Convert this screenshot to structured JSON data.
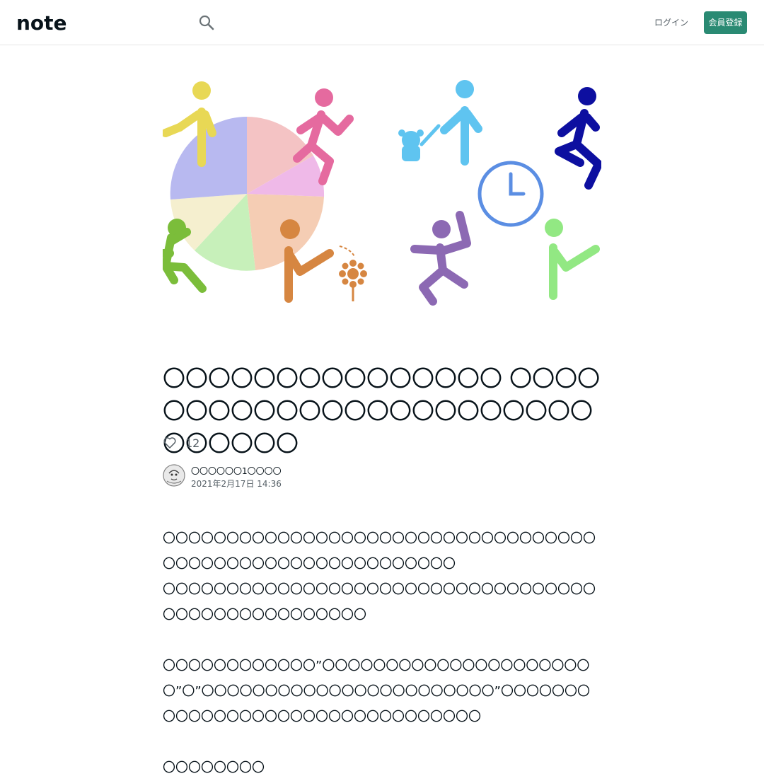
{
  "header": {
    "logo_text": "note",
    "login_label": "ログイン",
    "signup_label": "会員登録"
  },
  "colors": {
    "accent": "#2a8a73",
    "text": "#08131a",
    "muted": "#555f66"
  },
  "icons": {
    "search": "search-icon",
    "like": "heart-icon"
  },
  "article": {
    "title": "〇〇〇〇〇〇〇〇〇〇〇〇〇〇〇 〇〇〇〇〇〇〇〇〇〇〇〇〇〇〇〇〇〇〇〇〇〇〇〇〇〇〇〇〇",
    "like_count": "12",
    "author_name": "〇〇〇〇〇〇1〇〇〇〇",
    "date": "2021年2月17日 14:36",
    "paragraphs": [
      "〇〇〇〇〇〇〇〇〇〇〇〇〇〇〇〇〇〇〇〇〇〇〇〇〇〇〇〇〇〇〇〇〇〇〇〇〇〇〇〇〇〇〇〇〇〇〇〇〇〇〇〇〇〇〇〇〇",
      "〇〇〇〇〇〇〇〇〇〇〇〇〇〇〇〇〇〇〇〇〇〇〇〇〇〇〇〇〇〇〇〇〇〇〇〇〇〇〇〇〇〇〇〇〇〇〇〇〇〇",
      "",
      "〇〇〇〇〇〇〇〇〇〇〇〇”〇〇〇〇〇〇〇〇〇〇〇〇〇〇〇〇〇〇〇〇〇〇”〇”〇〇〇〇〇〇〇〇〇〇〇〇〇〇〇〇〇〇〇〇〇〇〇”〇〇〇〇〇〇〇〇〇〇〇〇〇〇〇〇〇〇〇〇〇〇〇〇〇〇〇〇〇〇〇〇",
      "",
      "〇〇〇〇〇〇〇〇"
    ]
  }
}
